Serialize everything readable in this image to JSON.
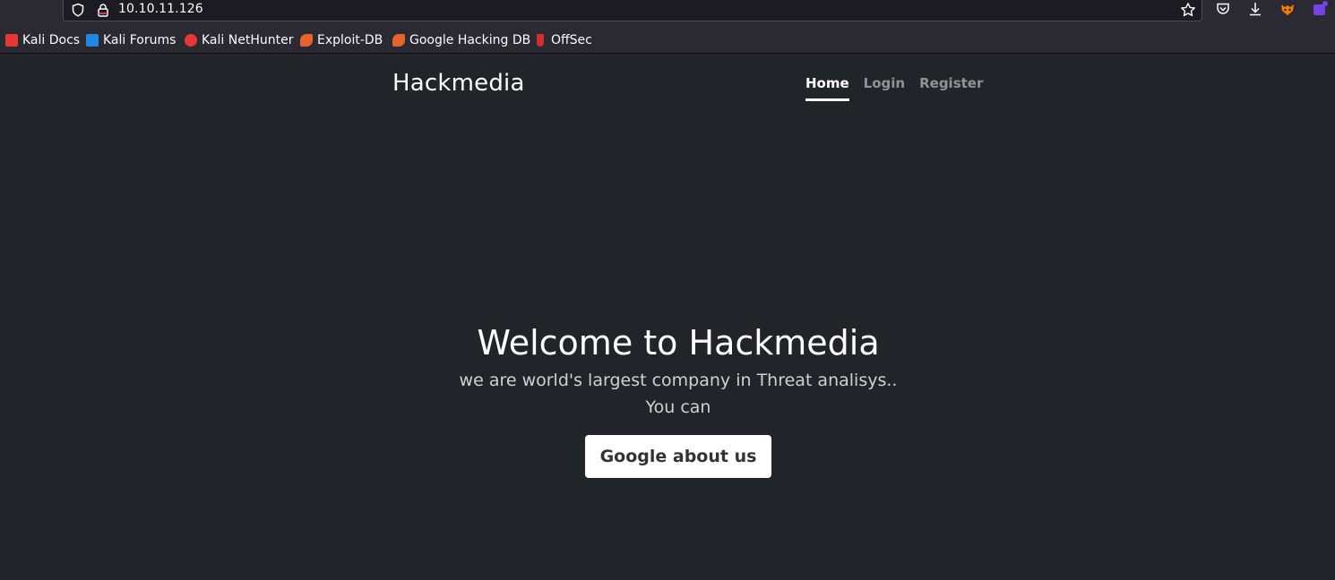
{
  "browser": {
    "url": "10.10.11.126",
    "bookmarks": [
      {
        "label": "Kali Docs",
        "icon": "kali-docs-icon",
        "color": "#e53935"
      },
      {
        "label": "Kali Forums",
        "icon": "kali-forums-icon",
        "color": "#1e88e5"
      },
      {
        "label": "Kali NetHunter",
        "icon": "kali-nethunter-icon",
        "color": "#e53935"
      },
      {
        "label": "Exploit-DB",
        "icon": "exploit-db-icon",
        "color": "#e8632b"
      },
      {
        "label": "Google Hacking DB",
        "icon": "ghdb-icon",
        "color": "#e8632b"
      },
      {
        "label": "OffSec",
        "icon": "offsec-icon",
        "color": "#d32f2f"
      }
    ]
  },
  "site": {
    "brand": "Hackmedia",
    "nav": [
      {
        "label": "Home",
        "active": true
      },
      {
        "label": "Login",
        "active": false
      },
      {
        "label": "Register",
        "active": false
      }
    ]
  },
  "hero": {
    "title": "Welcome to Hackmedia",
    "lead_line1": "we are world's largest company in Threat analisys..",
    "lead_line2": "You can",
    "cta_label": "Google about us"
  },
  "colors": {
    "page_bg": "#212529",
    "chrome_bg": "#2b2a33",
    "accent_purple": "#7542e5"
  }
}
